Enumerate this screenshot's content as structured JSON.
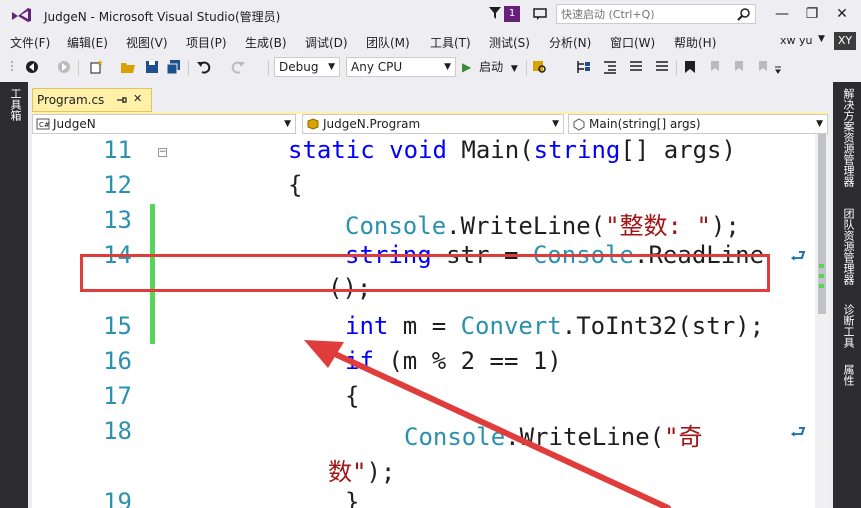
{
  "window": {
    "title": "JudgeN - Microsoft Visual Studio(管理员)",
    "notification_count": "1",
    "quick_launch_placeholder": "快速启动 (Ctrl+Q)",
    "minimize": "—",
    "restore": "❐",
    "close": "✕"
  },
  "menu": {
    "items": [
      "文件(F)",
      "编辑(E)",
      "视图(V)",
      "项目(P)",
      "生成(B)",
      "调试(D)",
      "团队(M)",
      "工具(T)",
      "测试(S)",
      "分析(N)",
      "窗口(W)",
      "帮助(H)"
    ],
    "user": "xw yu",
    "avatar_initials": "XY"
  },
  "toolbar": {
    "configuration": "Debug",
    "platform": "Any CPU",
    "start_label": "启动"
  },
  "side_panels": {
    "left": "工具箱",
    "right": [
      "解决方案资源管理器",
      "团队资源管理器",
      "诊断工具",
      "属性"
    ]
  },
  "document": {
    "tab_name": "Program.cs",
    "nav_project": "JudgeN",
    "nav_class": "JudgeN.Program",
    "nav_member": "Main(string[] args)"
  },
  "code": {
    "line_numbers": [
      "11",
      "12",
      "13",
      "14",
      "15",
      "16",
      "17",
      "18",
      "19"
    ],
    "lines": {
      "l11": {
        "kw1": "static",
        "kw2": "void",
        "name": "Main(",
        "kw3": "string",
        "rest": "[] args)"
      },
      "l12": {
        "text": "{"
      },
      "l13": {
        "type": "Console",
        "method": ".WriteLine(",
        "str": "\"整数: \"",
        "end": ");"
      },
      "l14": {
        "kw": "string",
        "mid": " str = ",
        "type": "Console",
        "method": ".ReadLine",
        "wrap": "();"
      },
      "l15": {
        "kw": "int",
        "mid": " m = ",
        "type": "Convert",
        "rest": ".ToInt32(str);"
      },
      "l16": {
        "kw": "if",
        "rest": " (m % 2 == 1)"
      },
      "l17": {
        "text": "{"
      },
      "l18": {
        "type": "Console",
        "method": ".WriteLine(",
        "str": "\"奇",
        "wrap_str": "数\"",
        "wrap_end": ");"
      },
      "l19": {
        "text": "}"
      }
    }
  },
  "colors": {
    "keyword": "#0000ff",
    "type": "#2b91af",
    "string": "#a31515",
    "line_number": "#2b91af",
    "change_bar": "#57d45a",
    "annotation": "#e03c3c",
    "tab_active": "#fff1a8"
  },
  "icons": [
    "vs-logo-icon",
    "filter-icon",
    "feedback-icon",
    "search-icon",
    "back-icon",
    "forward-icon",
    "new-project-icon",
    "open-icon",
    "save-icon",
    "save-all-icon",
    "undo-icon",
    "redo-icon",
    "play-icon",
    "pin-icon",
    "close-icon",
    "wrap-glyph-icon",
    "arrow-annotation-icon"
  ]
}
